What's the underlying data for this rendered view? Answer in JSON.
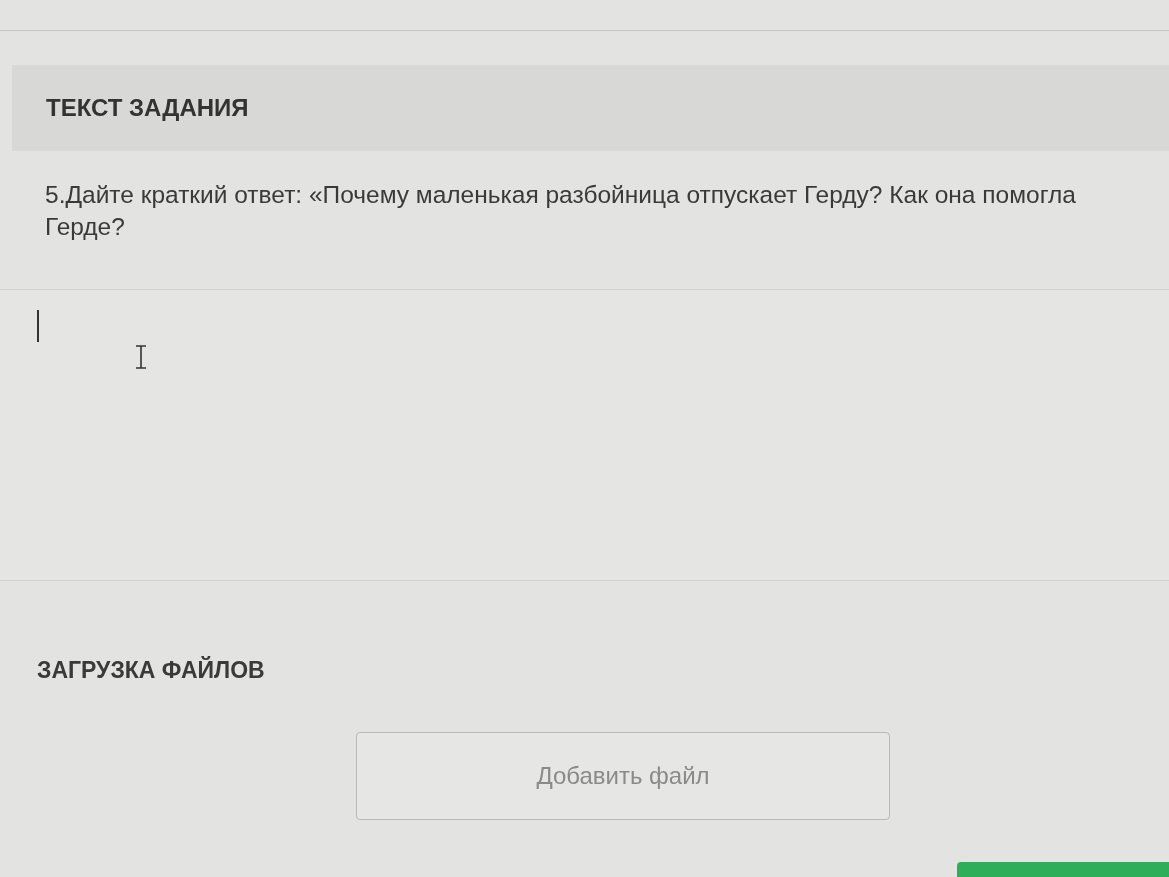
{
  "task_header": {
    "title": "ТЕКСТ ЗАДАНИЯ"
  },
  "question": {
    "text": "5.Дайте краткий ответ: «Почему маленькая разбойница отпускает Герду? Как она помогла Герде?"
  },
  "answer": {
    "focused": true
  },
  "upload": {
    "title": "ЗАГРУЗКА ФАЙЛОВ",
    "button": "Добавить файл"
  }
}
